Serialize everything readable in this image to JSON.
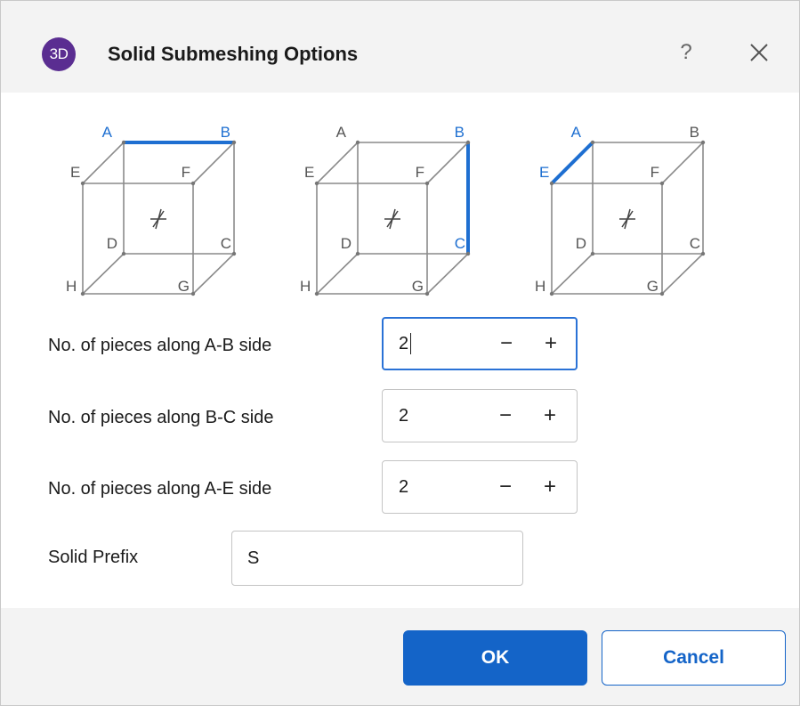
{
  "dialog": {
    "icon_text": "3D",
    "title": "Solid Submeshing Options",
    "help_label": "?",
    "icons": {
      "app": "app-3d-icon",
      "help": "help-icon",
      "close": "close-icon"
    }
  },
  "diagrams": [
    {
      "highlight": "A-B",
      "labels": {
        "A": "A",
        "B": "B",
        "C": "C",
        "D": "D",
        "E": "E",
        "F": "F",
        "G": "G",
        "H": "H"
      }
    },
    {
      "highlight": "B-C",
      "labels": {
        "A": "A",
        "B": "B",
        "C": "C",
        "D": "D",
        "E": "E",
        "F": "F",
        "G": "G",
        "H": "H"
      }
    },
    {
      "highlight": "A-E",
      "labels": {
        "A": "A",
        "B": "B",
        "C": "C",
        "D": "D",
        "E": "E",
        "F": "F",
        "G": "G",
        "H": "H"
      }
    }
  ],
  "fields": {
    "ab": {
      "label": "No. of pieces along A-B side",
      "value": "2",
      "minus": "−",
      "plus": "+"
    },
    "bc": {
      "label": "No. of pieces along B-C side",
      "value": "2",
      "minus": "−",
      "plus": "+"
    },
    "ae": {
      "label": "No. of pieces along A-E side",
      "value": "2",
      "minus": "−",
      "plus": "+"
    },
    "prefix": {
      "label": "Solid Prefix",
      "value": "S"
    }
  },
  "buttons": {
    "ok": "OK",
    "cancel": "Cancel"
  },
  "colors": {
    "accent": "#1464c8",
    "highlight_edge": "#1e6fd1",
    "app_icon": "#5a2d91"
  }
}
